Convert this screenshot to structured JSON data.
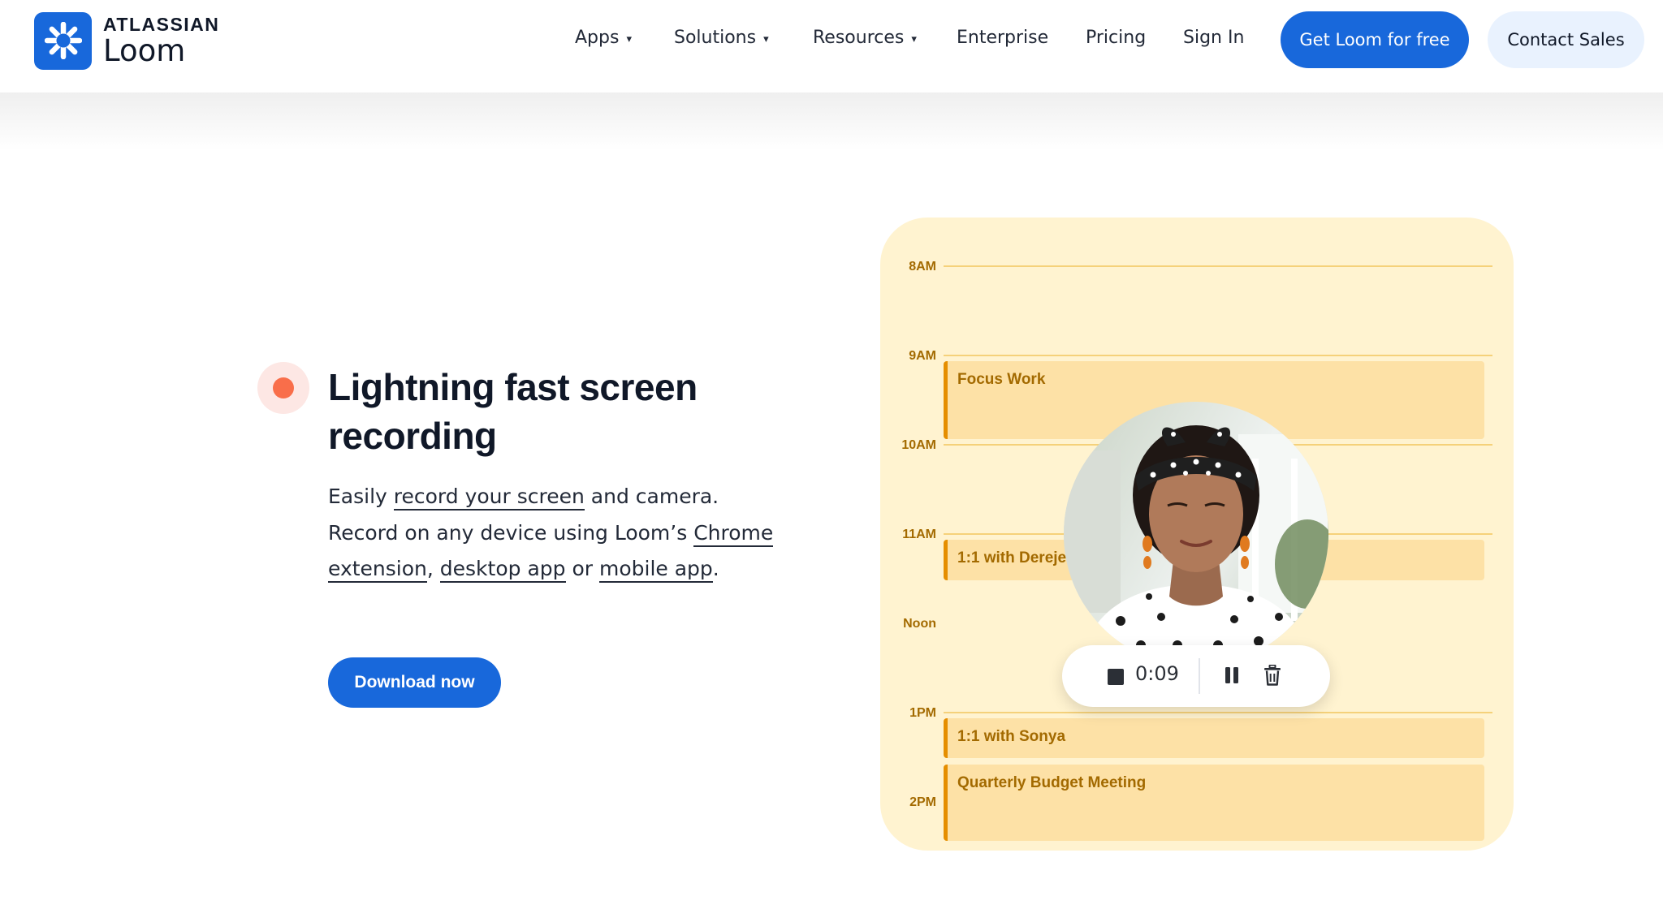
{
  "header": {
    "logo": {
      "brand": "ATLASSIAN",
      "product": "Loom",
      "icon": "loom-asterisk-icon",
      "color": "#1868db"
    },
    "nav": [
      {
        "label": "Apps",
        "dropdown": true
      },
      {
        "label": "Solutions",
        "dropdown": true
      },
      {
        "label": "Resources",
        "dropdown": true
      },
      {
        "label": "Enterprise",
        "dropdown": false
      },
      {
        "label": "Pricing",
        "dropdown": false
      },
      {
        "label": "Sign In",
        "dropdown": false
      }
    ],
    "caret": "▾",
    "cta_primary": "Get Loom for free",
    "cta_secondary": "Contact Sales"
  },
  "feature": {
    "badge_icon": "record-dot-icon",
    "title": "Lightning fast screen recording",
    "desc": {
      "part1": "Easily ",
      "link_screen": "record your screen",
      "part2": " and camera. Record on any device using Loom’s ",
      "link_chrome": "Chrome extension",
      "part3": ", ",
      "link_desktop": "desktop app",
      "part4": " or ",
      "link_mobile": "mobile app",
      "part5": "."
    },
    "cta": "Download now"
  },
  "calendar": {
    "hours": [
      "8AM",
      "9AM",
      "10AM",
      "11AM",
      "Noon",
      "1PM",
      "2PM"
    ],
    "events": [
      {
        "title": "Focus Work",
        "start_hour": "9AM"
      },
      {
        "title": "1:1 with Dereje",
        "start_hour": "11AM"
      },
      {
        "title": "1:1 with Sonya",
        "start_hour": "1PM"
      },
      {
        "title": "Quarterly Budget Meeting",
        "start_hour": "1PM"
      }
    ]
  },
  "recorder": {
    "timer": "0:09",
    "stop_icon": "stop-icon",
    "pause_icon": "pause-icon",
    "delete_icon": "trash-icon"
  },
  "colors": {
    "brand_blue": "#1868db",
    "calendar_bg": "#fff3d0",
    "event_bg": "#fde1a6",
    "event_accent": "#e58e00",
    "calendar_text": "#a36a00",
    "record_red": "#f96e4a"
  }
}
